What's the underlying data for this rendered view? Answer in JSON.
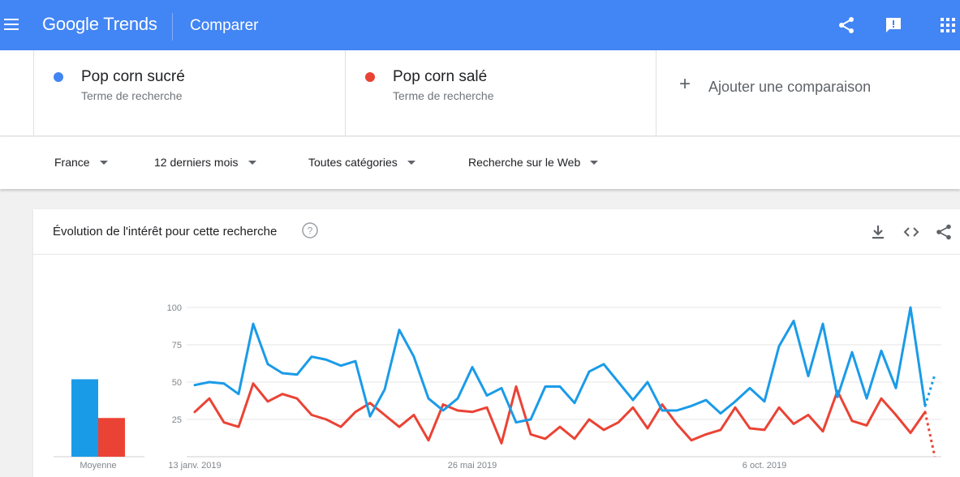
{
  "header": {
    "brand_google": "Google",
    "brand_trends": "Trends",
    "page_title": "Comparer",
    "icons": [
      "menu-icon",
      "share-icon",
      "feedback-icon",
      "apps-icon"
    ]
  },
  "terms": [
    {
      "name": "Pop corn sucré",
      "type": "Terme de recherche",
      "color": "#4285f4"
    },
    {
      "name": "Pop corn salé",
      "type": "Terme de recherche",
      "color": "#ea4335"
    }
  ],
  "add_comparison_label": "Ajouter une comparaison",
  "filters": {
    "region": "France",
    "period": "12 derniers mois",
    "category": "Toutes catégories",
    "search_type": "Recherche sur le Web"
  },
  "card": {
    "title": "Évolution de l'intérêt pour cette recherche",
    "icons": [
      "help-icon",
      "download-icon",
      "embed-icon",
      "share-icon"
    ]
  },
  "chart_data": {
    "type": "line",
    "ylim": [
      0,
      100
    ],
    "yticks": [
      "100",
      "75",
      "50",
      "25"
    ],
    "xtick_labels": [
      "13 janv. 2019",
      "26 mai 2019",
      "6 oct. 2019"
    ],
    "xtick_index": [
      0,
      19,
      39
    ],
    "grid": true,
    "series": [
      {
        "name": "Pop corn sucré",
        "color": "#1a9be8",
        "values": [
          48,
          50,
          49,
          42,
          89,
          62,
          56,
          55,
          67,
          65,
          61,
          64,
          27,
          45,
          85,
          67,
          39,
          31,
          39,
          60,
          41,
          46,
          23,
          25,
          47,
          47,
          36,
          57,
          62,
          50,
          38,
          50,
          31,
          31,
          34,
          38,
          29,
          37,
          46,
          37,
          74,
          91,
          54,
          89,
          40,
          70,
          39,
          71,
          46,
          100,
          34
        ],
        "partial": [
          34,
          55
        ]
      },
      {
        "name": "Pop corn salé",
        "color": "#ea4335",
        "values": [
          30,
          39,
          23,
          20,
          49,
          37,
          42,
          39,
          28,
          25,
          20,
          30,
          36,
          28,
          20,
          28,
          11,
          35,
          31,
          30,
          33,
          9,
          47,
          15,
          12,
          20,
          12,
          25,
          18,
          23,
          33,
          19,
          35,
          22,
          11,
          15,
          18,
          33,
          19,
          18,
          33,
          22,
          28,
          17,
          44,
          24,
          21,
          39,
          28,
          16,
          30
        ],
        "partial": [
          30,
          0
        ]
      }
    ],
    "average": {
      "label": "Moyenne",
      "values": [
        50,
        25
      ]
    }
  }
}
